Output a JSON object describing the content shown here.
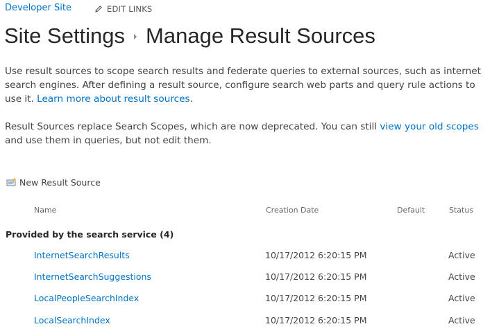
{
  "topbar": {
    "site_link": "Developer Site",
    "edit_links": "EDIT LINKS"
  },
  "title": {
    "parent": "Site Settings",
    "current": "Manage Result Sources"
  },
  "description": {
    "p1_text": "Use result sources to scope search results and federate queries to external sources, such as internet search engines. After defining a result source, configure search web parts and query rule actions to use it. ",
    "p1_link": "Learn more about result sources",
    "p1_end": ".",
    "p2_text": "Result Sources replace Search Scopes, which are now deprecated. You can still ",
    "p2_link": "view your old scopes",
    "p2_end": " and use them in queries, but not edit them."
  },
  "toolbar": {
    "new_result_source": "New Result Source"
  },
  "table": {
    "columns": {
      "name": "Name",
      "creation_date": "Creation Date",
      "default": "Default",
      "status": "Status"
    },
    "group_heading": "Provided by the search service (4)",
    "rows": [
      {
        "name": "InternetSearchResults",
        "creation_date": "10/17/2012 6:20:15 PM",
        "default": "",
        "status": "Active"
      },
      {
        "name": "InternetSearchSuggestions",
        "creation_date": "10/17/2012 6:20:15 PM",
        "default": "",
        "status": "Active"
      },
      {
        "name": "LocalPeopleSearchIndex",
        "creation_date": "10/17/2012 6:20:15 PM",
        "default": "",
        "status": "Active"
      },
      {
        "name": "LocalSearchIndex",
        "creation_date": "10/17/2012 6:20:15 PM",
        "default": "",
        "status": "Active"
      }
    ]
  },
  "colors": {
    "link": "#0072c6",
    "text": "#444444",
    "title": "#262626"
  },
  "icons": {
    "edit": "pencil-icon",
    "breadcrumb_separator": "breadcrumb-arrow-icon",
    "new_source": "new-result-source-icon"
  }
}
